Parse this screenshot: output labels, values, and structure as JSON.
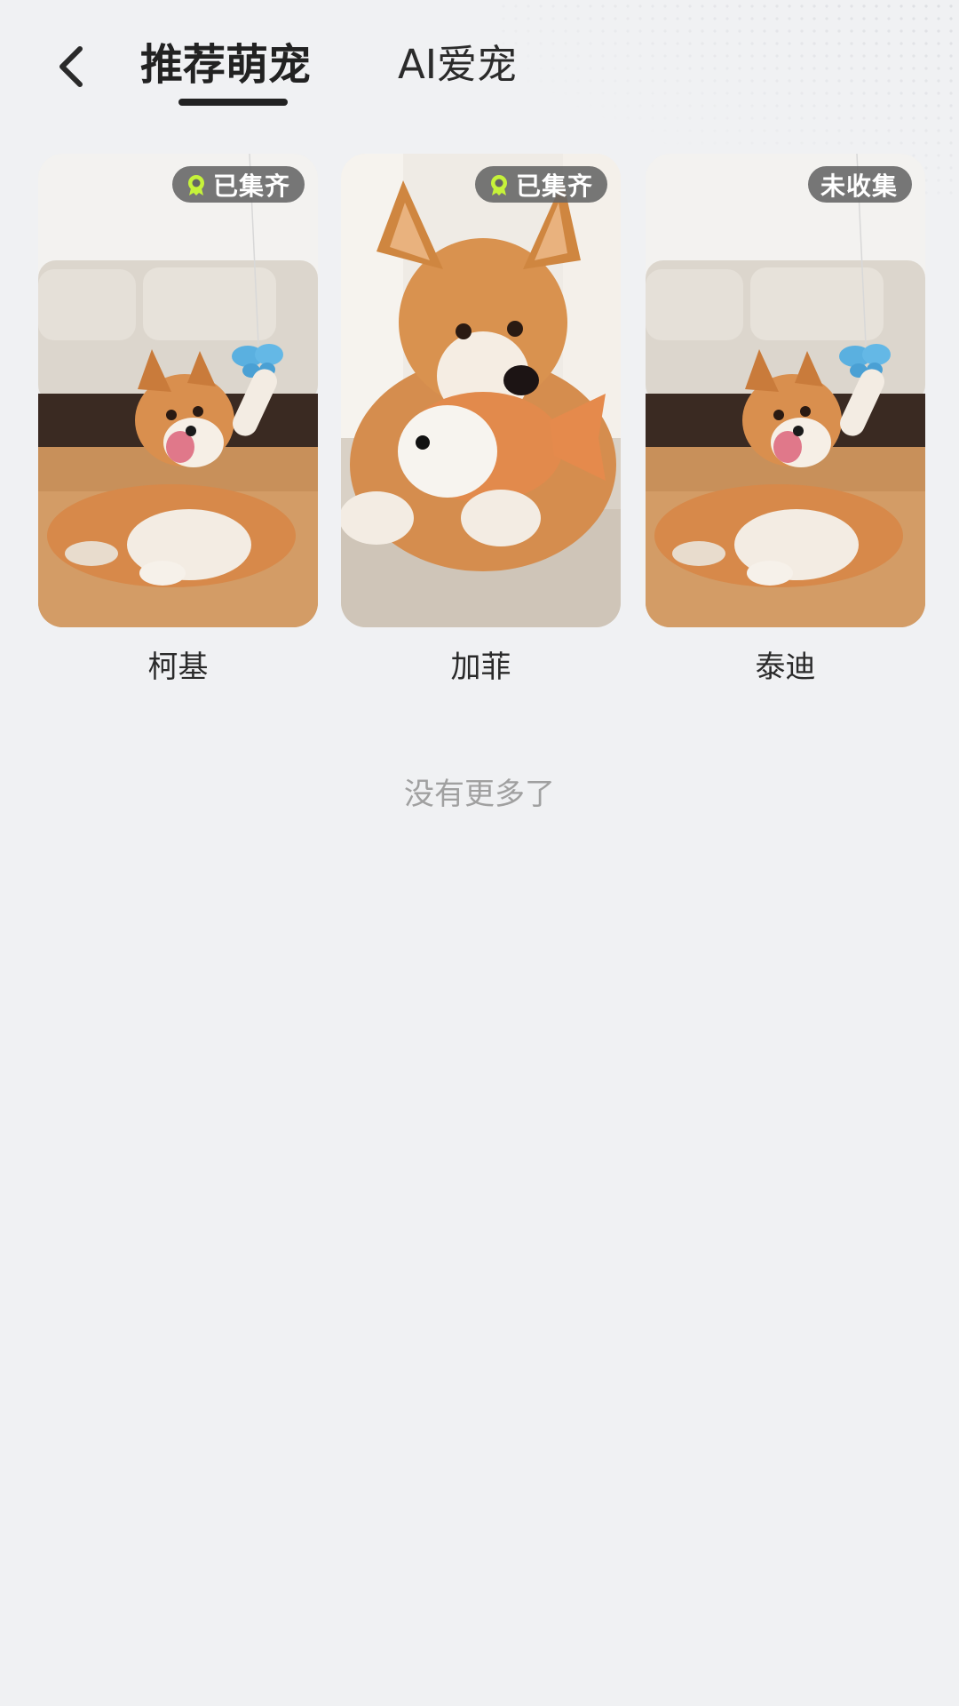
{
  "header": {
    "tabs": [
      {
        "label": "推荐萌宠",
        "active": true
      },
      {
        "label": "AI爱宠",
        "active": false
      }
    ]
  },
  "pets": [
    {
      "name": "柯基",
      "status": "已集齐",
      "collected": true,
      "image": "corgi-playing-with-butterfly"
    },
    {
      "name": "加菲",
      "status": "已集齐",
      "collected": true,
      "image": "corgi-with-fish-plush"
    },
    {
      "name": "泰迪",
      "status": "未收集",
      "collected": false,
      "image": "corgi-playing-with-butterfly"
    }
  ],
  "footer": {
    "text": "没有更多了"
  },
  "colors": {
    "background": "#f0f1f3",
    "badge_bg": "#646464",
    "badge_icon": "#c6f23a",
    "muted_text": "#a0a0a0"
  }
}
